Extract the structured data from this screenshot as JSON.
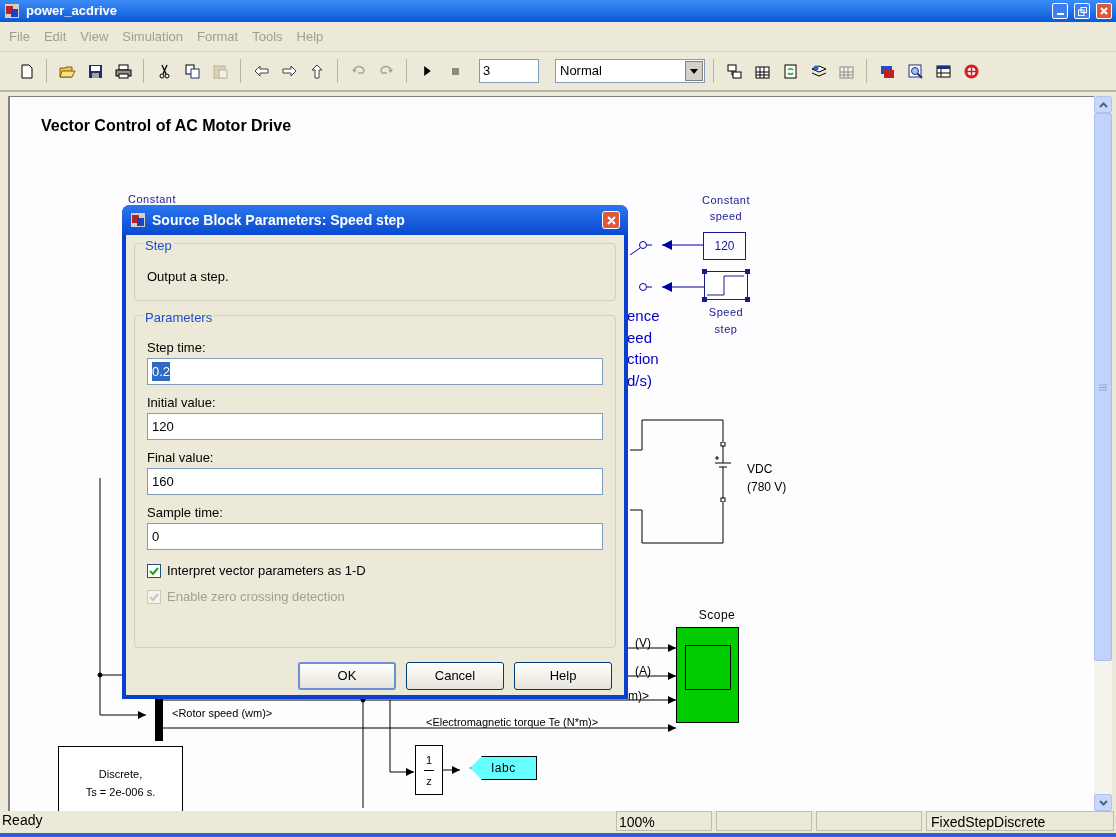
{
  "window": {
    "title": "power_acdrive"
  },
  "menu": [
    {
      "label": "File",
      "disabled": true
    },
    {
      "label": "Edit",
      "disabled": true
    },
    {
      "label": "View",
      "disabled": true
    },
    {
      "label": "Simulation",
      "disabled": true
    },
    {
      "label": "Format",
      "disabled": true
    },
    {
      "label": "Tools",
      "disabled": true
    },
    {
      "label": "Help",
      "disabled": true
    }
  ],
  "toolbar": {
    "groups": [
      [
        {
          "kind": "new",
          "disabled": false
        }
      ],
      [
        {
          "kind": "open",
          "disabled": false
        },
        {
          "kind": "save",
          "disabled": false
        },
        {
          "kind": "print",
          "disabled": false
        }
      ],
      [
        {
          "kind": "cut",
          "disabled": false
        },
        {
          "kind": "copy",
          "disabled": false
        },
        {
          "kind": "paste",
          "disabled": true
        }
      ],
      [
        {
          "kind": "back",
          "disabled": false
        },
        {
          "kind": "forward",
          "disabled": false
        },
        {
          "kind": "up",
          "disabled": false
        }
      ],
      [
        {
          "kind": "undo",
          "disabled": true
        },
        {
          "kind": "redo",
          "disabled": true
        }
      ],
      [
        {
          "kind": "play",
          "disabled": false
        },
        {
          "kind": "stop",
          "disabled": true
        }
      ]
    ],
    "stop_time": "3",
    "mode": "Normal",
    "tools": [
      [
        {
          "kind": "library",
          "disabled": false
        },
        {
          "kind": "grid",
          "disabled": false
        },
        {
          "kind": "refresh",
          "disabled": false
        },
        {
          "kind": "layers",
          "disabled": false
        },
        {
          "kind": "grid",
          "disabled": true
        }
      ],
      [
        {
          "kind": "debug",
          "disabled": false
        },
        {
          "kind": "inspect",
          "disabled": false
        },
        {
          "kind": "explorer",
          "disabled": false
        },
        {
          "kind": "target",
          "disabled": false
        }
      ]
    ]
  },
  "diagram": {
    "title": "Vector Control of AC Motor Drive",
    "blocks": [
      {
        "kind": "constant",
        "label": "Constant speed",
        "value": "120",
        "selected": false
      },
      {
        "kind": "step",
        "label": "Speed step",
        "selected": true
      },
      {
        "kind": "dc_source",
        "label": "VDC",
        "rating": "(780 V)"
      },
      {
        "kind": "scope",
        "label": "Scope"
      },
      {
        "kind": "unit_delay",
        "numerator": "1",
        "denominator": "z"
      },
      {
        "kind": "goto",
        "tag": "Iabc"
      },
      {
        "kind": "powergui",
        "lines": [
          "Discrete,",
          "Ts = 2e-006 s."
        ]
      }
    ],
    "labels": [
      "Constant",
      "ence",
      "eed",
      "ction",
      "d/s)",
      "(V)",
      "(A)",
      "m)>",
      "<Rotor speed (wm)>",
      "<Electromagnetic torque Te (N*m)>"
    ]
  },
  "dialog": {
    "title": "Source Block Parameters: Speed step",
    "description_group": {
      "title": "Step",
      "text": "Output a step."
    },
    "parameters_group": {
      "title": "Parameters"
    },
    "fields": [
      {
        "label": "Step time:",
        "value": "0.2",
        "selected": true
      },
      {
        "label": "Initial value:",
        "value": "120",
        "selected": false
      },
      {
        "label": "Final value:",
        "value": "160",
        "selected": false
      },
      {
        "label": "Sample time:",
        "value": "0",
        "selected": false
      }
    ],
    "checkboxes": [
      {
        "label": "Interpret vector parameters as 1-D",
        "checked": true,
        "disabled": false
      },
      {
        "label": "Enable zero crossing detection",
        "checked": true,
        "disabled": true
      }
    ],
    "buttons": [
      {
        "label": "OK",
        "default": true
      },
      {
        "label": "Cancel",
        "default": false
      },
      {
        "label": "Help",
        "default": false
      }
    ]
  },
  "status_bar": {
    "status": "Ready",
    "zoom": "100%",
    "solver": "FixedStepDiscrete"
  }
}
